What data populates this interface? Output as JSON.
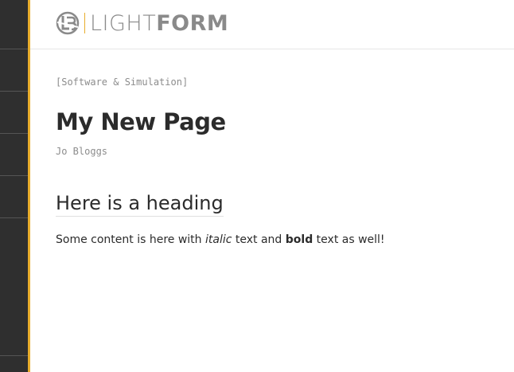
{
  "brand": {
    "logo_light": "LIGHT",
    "logo_bold": "FORM",
    "accent_color": "#e8ad2c",
    "sidebar_color": "#2f2f2f"
  },
  "page": {
    "category": "[Software & Simulation]",
    "title": "My New Page",
    "author": "Jo Bloggs"
  },
  "article": {
    "heading": "Here is a heading",
    "paragraph": {
      "part1": "Some content is here with ",
      "italic": "italic",
      "part2": " text and ",
      "bold": "bold",
      "part3": " text as well!"
    }
  }
}
